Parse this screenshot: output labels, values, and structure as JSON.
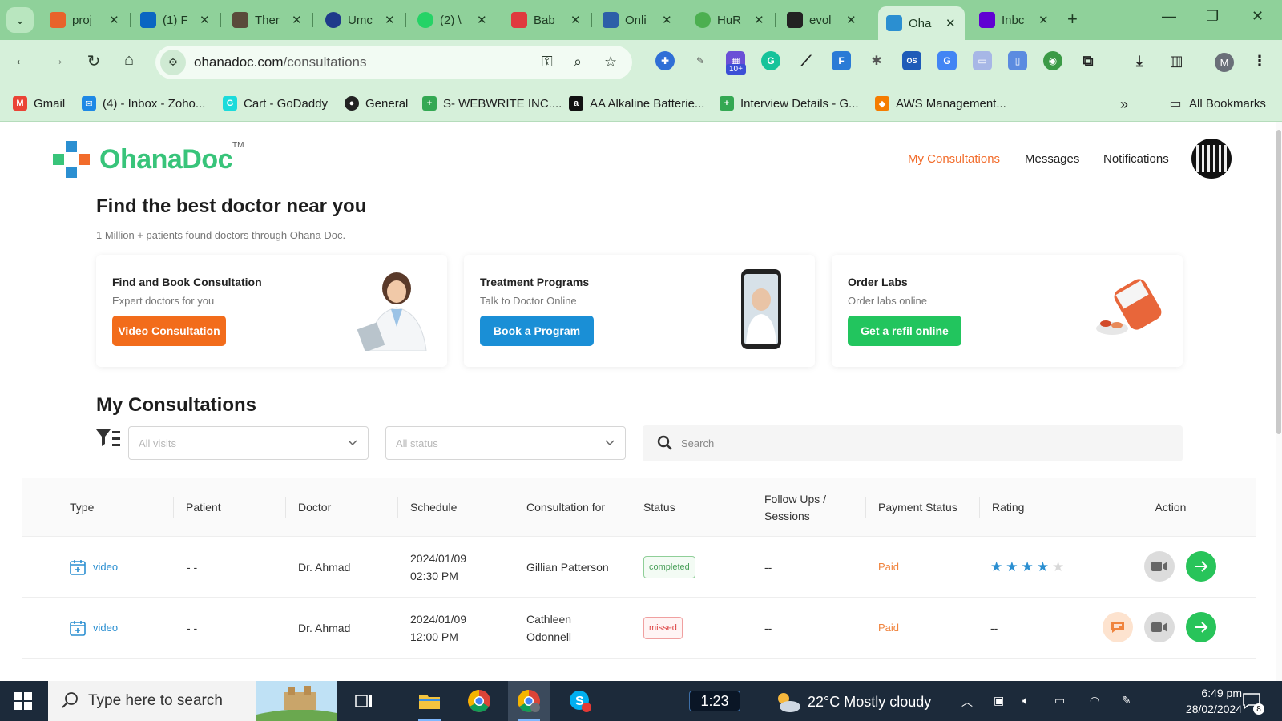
{
  "browser": {
    "tabs": [
      {
        "label": "proj",
        "color": "#e8632b"
      },
      {
        "label": "(1) F",
        "color": "#0a66c2"
      },
      {
        "label": "Ther",
        "color": "#5a4a3a"
      },
      {
        "label": "Umc",
        "color": "#1e3a8a"
      },
      {
        "label": "(2) \\",
        "color": "#25d366"
      },
      {
        "label": "Bab",
        "color": "#e0393e"
      },
      {
        "label": "Onli",
        "color": "#2d5fa8"
      },
      {
        "label": "HuR",
        "color": "#4caf50"
      },
      {
        "label": "evol",
        "color": "#222222"
      },
      {
        "label": "Oha",
        "color": "#2b8fd1"
      },
      {
        "label": "Inbc",
        "color": "#6001d2"
      }
    ],
    "url_domain": "ohanadoc.com",
    "url_path": "/consultations",
    "ext_badge": "10+",
    "profile_initial": "M",
    "bookmarks": [
      {
        "label": "Gmail",
        "color": "#ea4335",
        "glyph": "M"
      },
      {
        "label": "(4) - Inbox - Zoho...",
        "color": "#1e88e5",
        "glyph": "✉"
      },
      {
        "label": "Cart - GoDaddy",
        "color": "#1bdbdb",
        "glyph": "G"
      },
      {
        "label": "General",
        "color": "#222222",
        "glyph": "●"
      },
      {
        "label": "S- WEBWRITE INC....",
        "color": "#34a853",
        "glyph": "+"
      },
      {
        "label": "AA Alkaline Batterie...",
        "color": "#111111",
        "glyph": "a"
      },
      {
        "label": "Interview Details - G...",
        "color": "#34a853",
        "glyph": "+"
      },
      {
        "label": "AWS Management...",
        "color": "#f57c00",
        "glyph": "◆"
      }
    ],
    "bookmarks_more": "»",
    "all_bookmarks": "All Bookmarks"
  },
  "header": {
    "logo_text": "OhanaDoc",
    "logo_tm": "TM",
    "nav": [
      {
        "label": "My Consultations",
        "active": true
      },
      {
        "label": "Messages",
        "active": false
      },
      {
        "label": "Notifications",
        "active": false
      }
    ]
  },
  "hero": {
    "title": "Find the best doctor near you",
    "subtitle": "1 Million + patients found doctors through Ohana Doc."
  },
  "cards": [
    {
      "title": "Find and Book Consultation",
      "subtitle": "Expert doctors for you",
      "button": "Video Consultation",
      "color": "#f26c1b"
    },
    {
      "title": "Treatment Programs",
      "subtitle": "Talk to Doctor Online",
      "button": "Book a Program",
      "color": "#1a8fd6"
    },
    {
      "title": "Order Labs",
      "subtitle": "Order labs online",
      "button": "Get a refil online",
      "color": "#22c55e"
    }
  ],
  "consultations": {
    "title": "My Consultations",
    "filter_visits_placeholder": "All visits",
    "filter_status_placeholder": "All status",
    "search_placeholder": "Search",
    "columns": [
      "Type",
      "Patient",
      "Doctor",
      "Schedule",
      "Consultation for",
      "Status",
      "Follow Ups / Sessions",
      "Payment Status",
      "Rating",
      "Action"
    ],
    "rows": [
      {
        "type": "video",
        "patient": "- -",
        "doctor": "Dr. Ahmad",
        "schedule_date": "2024/01/09",
        "schedule_time": "02:30 PM",
        "consultation_for": "Gillian Patterson",
        "status": "completed",
        "followups": "--",
        "payment": "Paid",
        "rating": 4,
        "rating_text": "",
        "has_chat": false
      },
      {
        "type": "video",
        "patient": "- -",
        "doctor": "Dr. Ahmad",
        "schedule_date": "2024/01/09",
        "schedule_time": "12:00 PM",
        "consultation_for": "Cathleen Odonnell",
        "status": "missed",
        "followups": "--",
        "payment": "Paid",
        "rating": 0,
        "rating_text": "--",
        "has_chat": true
      }
    ]
  },
  "taskbar": {
    "search_placeholder": "Type here to search",
    "timer": "1:23",
    "weather": "22°C  Mostly cloudy",
    "time": "6:49 pm",
    "date": "28/02/2024",
    "notification_count": "8",
    "colors": {
      "accent": "#f26c2b",
      "brand_green": "#38c47a",
      "link_blue": "#2b8fd1"
    }
  }
}
